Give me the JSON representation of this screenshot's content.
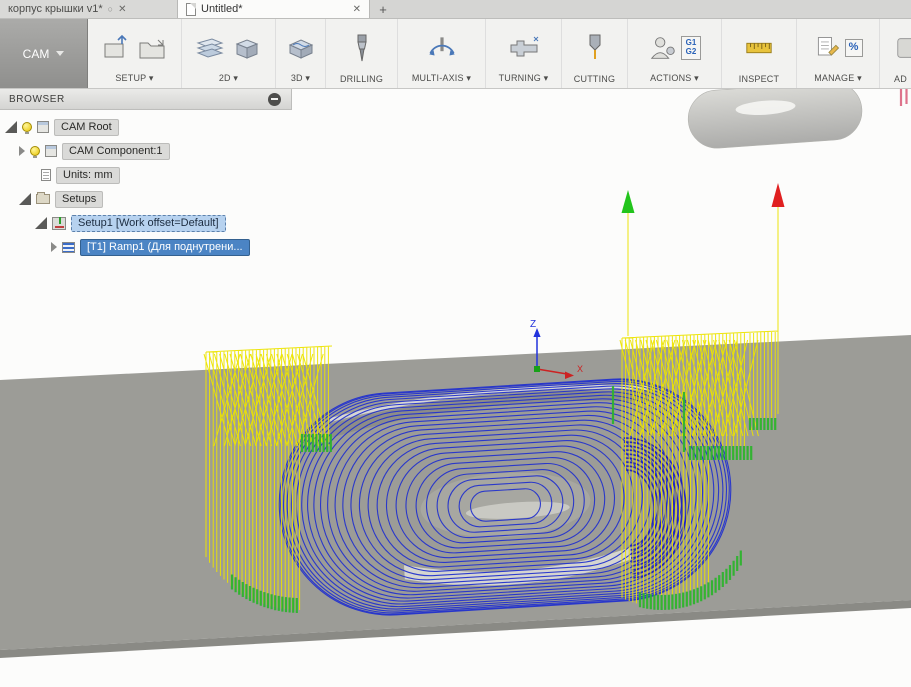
{
  "tabs": {
    "items": [
      {
        "label": "корпус крышки v1*"
      },
      {
        "label": "Untitled*"
      }
    ],
    "dot_glyph": "○",
    "close_glyph": "✕",
    "new_tab_glyph": "+"
  },
  "ribbon": {
    "workspace_label": "CAM",
    "groups": [
      {
        "label": "SETUP ▾"
      },
      {
        "label": "2D ▾"
      },
      {
        "label": "3D ▾"
      },
      {
        "label": "DRILLING"
      },
      {
        "label": "MULTI-AXIS ▾"
      },
      {
        "label": "TURNING ▾"
      },
      {
        "label": "CUTTING"
      },
      {
        "label": "ACTIONS ▾",
        "badge_top": "G1",
        "badge_bottom": "G2"
      },
      {
        "label": "INSPECT"
      },
      {
        "label": "MANAGE ▾",
        "badge": "%"
      },
      {
        "label": "AD"
      }
    ]
  },
  "browser": {
    "title": "BROWSER",
    "tree": [
      {
        "label": "CAM Root"
      },
      {
        "label": "CAM Component:1"
      },
      {
        "label": "Units: mm"
      },
      {
        "label": "Setups"
      },
      {
        "label": "Setup1 [Work offset=Default]"
      },
      {
        "label": "[T1] Ramp1 (Для поднутрени..."
      }
    ]
  },
  "viewport": {
    "axis": {
      "z": "Z",
      "x": "X"
    },
    "colors": {
      "background": "#fcfcfb",
      "ground": "#9c9c97",
      "ground_edge": "#8a8a85",
      "pocket_wall": "#8d8d88",
      "rim_highlight": "#dededa",
      "floor": "#a7a7a1",
      "floor_light": "#dcdcd6",
      "toolpath_cut": "#2433cc",
      "toolpath_cut_dense": "#1a1ac2",
      "toolpath_rapid": "#ece400",
      "toolpath_lead": "#2db32d",
      "marker_start": "#22c41c",
      "marker_end": "#e02020",
      "capsule_light": "#d8d8d4",
      "capsule_dark": "#aeaeaa",
      "edge_red": "#d85a78"
    }
  }
}
